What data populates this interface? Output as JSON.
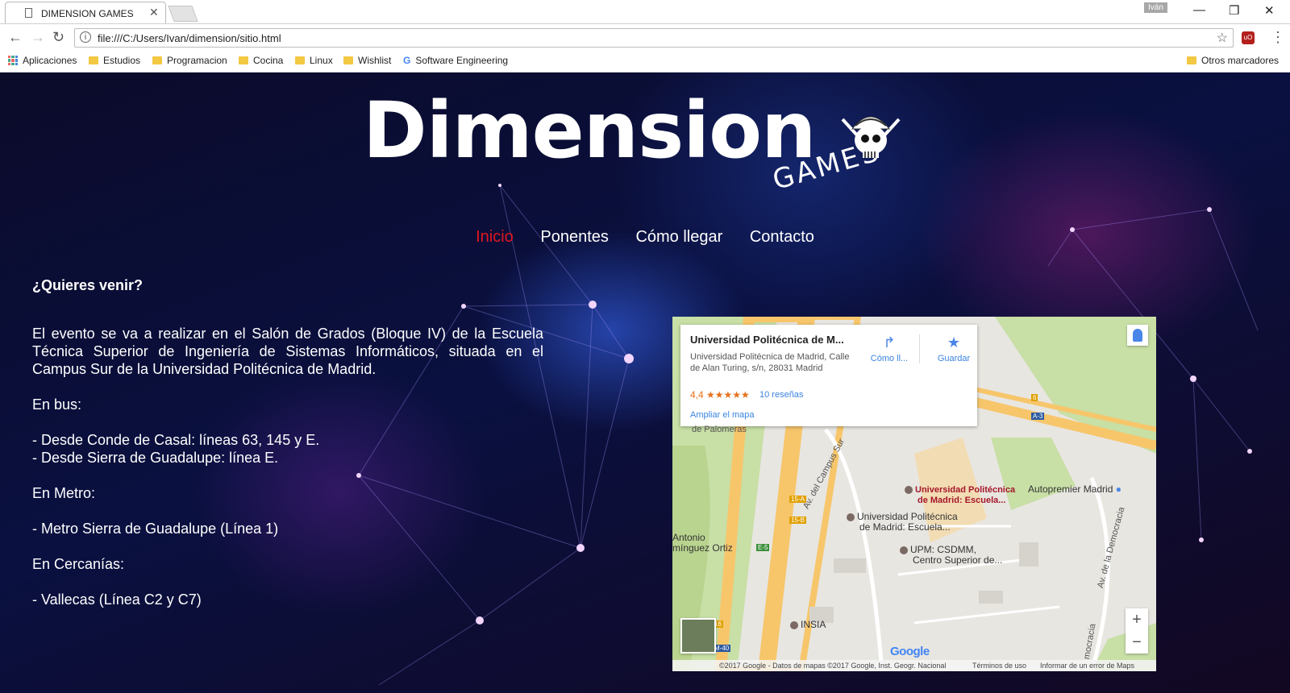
{
  "browser": {
    "tab_title": "DIMENSION GAMES",
    "user": "Iván",
    "url": "file:///C:/Users/Ivan/dimension/sitio.html",
    "bookmarks": [
      "Aplicaciones",
      "Estudios",
      "Programacion",
      "Cocina",
      "Linux",
      "Wishlist",
      "Software Engineering"
    ],
    "other_bookmarks": "Otros marcadores"
  },
  "logo": {
    "word": "Dimension",
    "sub": "GAMES"
  },
  "nav": {
    "items": [
      "Inicio",
      "Ponentes",
      "Cómo llegar",
      "Contacto"
    ],
    "active": "Inicio",
    "active_color": "#e0161e"
  },
  "content": {
    "heading": "¿Quieres venir?",
    "intro": "El evento se va a realizar en el Salón de Grados (Bloque IV) de la Escuela Técnica Superior de Ingeniería de Sistemas Informáticos, situada en el Campus Sur de la Universidad Politécnica de Madrid.",
    "bus_title": "En bus:",
    "bus_line1": "- Desde Conde de Casal: líneas 63, 145 y E.",
    "bus_line2": "- Desde Sierra de Guadalupe: línea E.",
    "metro_title": "En Metro:",
    "metro_line": "- Metro Sierra de Guadalupe (Línea 1)",
    "cercanias_title": "En Cercanías:",
    "cercanias_line": "- Vallecas (Línea C2 y C7)"
  },
  "map": {
    "card": {
      "name": "Universidad Politécnica de M...",
      "address": "Universidad Politécnica de Madrid, Calle de Alan Turing, s/n, 28031 Madrid",
      "rating": "4,4 ★★★★★",
      "reviews": "10 reseñas",
      "enlarge": "Ampliar el mapa",
      "directions": "Cómo ll...",
      "save": "Guardar"
    },
    "labels": {
      "upm_red_1": "Universidad Politécnica",
      "upm_red_2": "de Madrid: Escuela...",
      "autopremier": "Autopremier Madrid",
      "upm_1": "Universidad Politécnica",
      "upm_2": "de Madrid: Escuela...",
      "csdmm_1": "UPM: CSDMM,",
      "csdmm_2": "Centro Superior de...",
      "insia": "INSIA",
      "antonio_1": "Antonio",
      "antonio_2": "mínguez Ortiz",
      "campus_sur": "Av. del Campus Sur",
      "democracia": "Av. de la Democracia",
      "palomeras": "de Palomeras",
      "democracia_short": "mocracia"
    },
    "shields": [
      "A-3",
      "15-A",
      "15-B",
      "E-5",
      "M-40",
      "6",
      "16"
    ],
    "zoom_in": "+",
    "zoom_out": "−",
    "google": "Google",
    "attribution": "©2017 Google - Datos de mapas ©2017 Google, Inst. Geogr. Nacional",
    "terms": "Términos de uso",
    "report": "Informar de un error de Maps"
  }
}
